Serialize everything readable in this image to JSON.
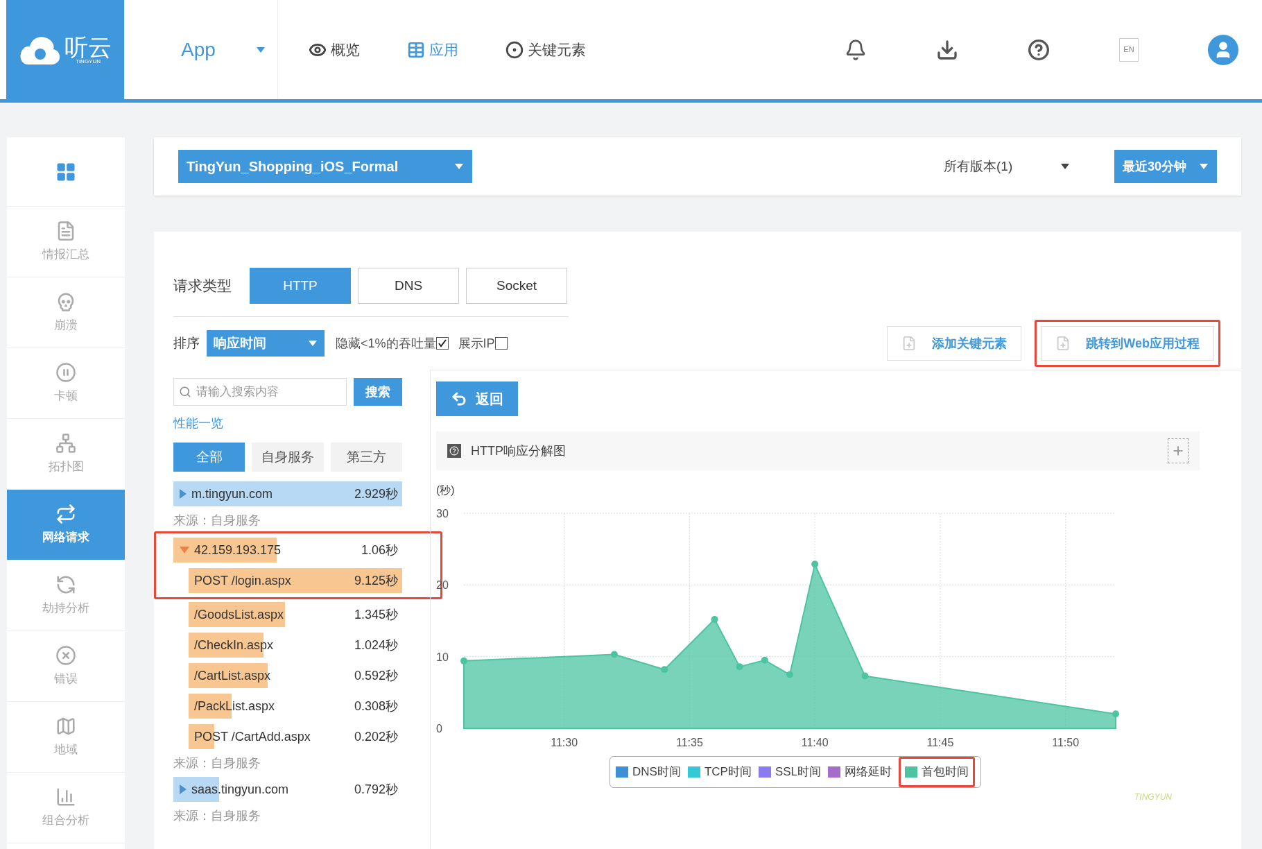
{
  "logo": {
    "text": "听云",
    "subtext": "TINGYUN"
  },
  "app_menu": {
    "label": "App"
  },
  "nav": [
    {
      "label": "概览",
      "selected": false
    },
    {
      "label": "应用",
      "selected": true
    },
    {
      "label": "关键元素",
      "selected": false
    }
  ],
  "language_button": "EN",
  "sidebar": {
    "items": [
      {
        "label": "情报汇总",
        "selected": false
      },
      {
        "label": "崩溃",
        "selected": false
      },
      {
        "label": "卡顿",
        "selected": false
      },
      {
        "label": "拓扑图",
        "selected": false
      },
      {
        "label": "网络请求",
        "selected": true
      },
      {
        "label": "劫持分析",
        "selected": false
      },
      {
        "label": "错误",
        "selected": false
      },
      {
        "label": "地域",
        "selected": false
      },
      {
        "label": "组合分析",
        "selected": false
      }
    ]
  },
  "filters": {
    "app": "TingYun_Shopping_iOS_Formal",
    "version": "所有版本(1)",
    "time_range": "最近30分钟"
  },
  "request_type": {
    "label": "请求类型",
    "tabs": [
      {
        "label": "HTTP",
        "selected": true
      },
      {
        "label": "DNS",
        "selected": false
      },
      {
        "label": "Socket",
        "selected": false
      }
    ]
  },
  "sort": {
    "label": "排序",
    "value": "响应时间"
  },
  "options": [
    {
      "label": "隐藏<1%的吞吐量",
      "checked": true
    },
    {
      "label": "展示IP",
      "checked": false
    }
  ],
  "actions": [
    {
      "label": "添加关键元素",
      "annotated": false
    },
    {
      "label": "跳转到Web应用过程",
      "annotated": true
    }
  ],
  "search": {
    "placeholder": "请输入搜索内容",
    "button": "搜索"
  },
  "overview_link": "性能一览",
  "scope_tabs": [
    {
      "label": "全部",
      "selected": true
    },
    {
      "label": "自身服务",
      "selected": false
    },
    {
      "label": "第三方",
      "selected": false
    }
  ],
  "hosts": [
    {
      "name": "m.tingyun.com",
      "time": "2.929秒",
      "level": 1,
      "expanded": false,
      "annotated": false,
      "source": "来源：自身服务"
    },
    {
      "name": "42.159.193.175",
      "time": "1.06秒",
      "level": 0.45,
      "expanded": true,
      "annotated": true,
      "source": "来源：自身服务",
      "children": [
        {
          "name": "POST /login.aspx",
          "time": "9.125秒",
          "level": 1,
          "annotated": true
        },
        {
          "name": "/GoodsList.aspx",
          "time": "1.345秒",
          "level": 0.45,
          "annotated": false
        },
        {
          "name": "/CheckIn.aspx",
          "time": "1.024秒",
          "level": 0.35,
          "annotated": false
        },
        {
          "name": "/CartList.aspx",
          "time": "0.592秒",
          "level": 0.37,
          "annotated": false
        },
        {
          "name": "/PackList.aspx",
          "time": "0.308秒",
          "level": 0.2,
          "annotated": false
        },
        {
          "name": "POST /CartAdd.aspx",
          "time": "0.202秒",
          "level": 0.12,
          "annotated": false
        }
      ]
    },
    {
      "name": "saas.tingyun.com",
      "time": "0.792秒",
      "level": 0.2,
      "expanded": false,
      "annotated": false,
      "source": "来源：自身服务"
    }
  ],
  "back_button": "返回",
  "chart_panel": {
    "title": "HTTP响应分解图",
    "credit": "TINGYUN",
    "legend_annotated": [
      false,
      false,
      false,
      false,
      true
    ],
    "chart_data": {
      "type": "area",
      "ylabel": "(秒)",
      "grid": true,
      "x": [
        686,
        692,
        694,
        696,
        697,
        698,
        699,
        700,
        702,
        712
      ],
      "xlim": [
        686,
        712
      ],
      "ylim": [
        0,
        30
      ],
      "xticks": [
        {
          "value": 690,
          "label": "11:30"
        },
        {
          "value": 695,
          "label": "11:35"
        },
        {
          "value": 700,
          "label": "11:40"
        },
        {
          "value": 705,
          "label": "11:45"
        },
        {
          "value": 710,
          "label": "11:50"
        }
      ],
      "yticks": [
        0,
        10,
        20,
        30
      ],
      "series": [
        {
          "name": "DNS时间",
          "color": "#3d8fd6",
          "values": [
            null,
            null,
            null,
            null,
            null,
            null,
            null,
            null,
            null,
            null
          ]
        },
        {
          "name": "TCP时间",
          "color": "#35c9d6",
          "values": [
            null,
            null,
            null,
            null,
            null,
            null,
            null,
            null,
            null,
            null
          ]
        },
        {
          "name": "SSL时间",
          "color": "#8a7cf0",
          "values": [
            null,
            null,
            null,
            null,
            null,
            null,
            null,
            null,
            null,
            null
          ]
        },
        {
          "name": "网络延时",
          "color": "#a56cc9",
          "values": [
            null,
            null,
            null,
            null,
            null,
            null,
            null,
            null,
            null,
            null
          ]
        },
        {
          "name": "首包时间",
          "color": "#4cc4a2",
          "values": [
            9.4,
            10.3,
            8.2,
            15.2,
            8.6,
            9.5,
            7.5,
            22.9,
            7.3,
            2
          ]
        }
      ]
    }
  }
}
